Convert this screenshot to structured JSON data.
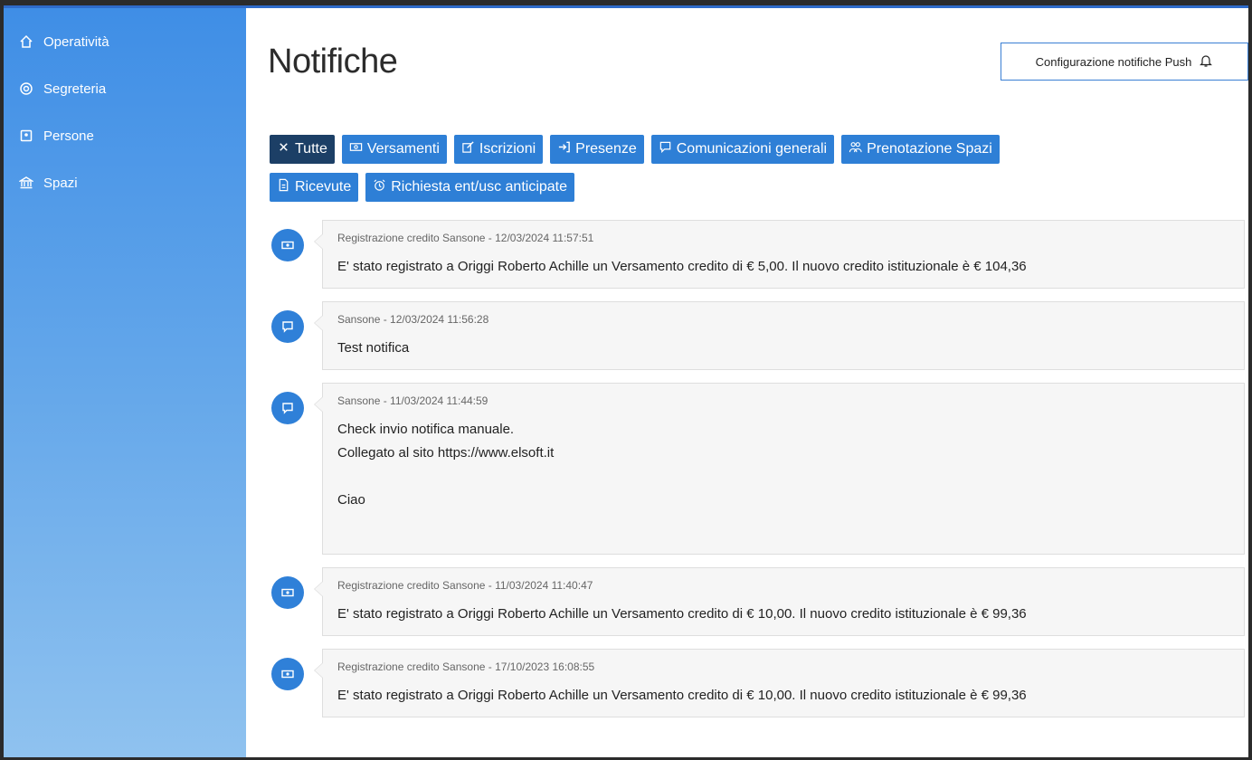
{
  "sidebar": {
    "items": [
      {
        "label": "Operatività",
        "icon": "home-icon"
      },
      {
        "label": "Segreteria",
        "icon": "lifebuoy-icon"
      },
      {
        "label": "Persone",
        "icon": "id-card-icon"
      },
      {
        "label": "Spazi",
        "icon": "bank-icon"
      }
    ]
  },
  "header": {
    "title": "Notifiche",
    "push_button_label": "Configurazione notifiche Push"
  },
  "filters": [
    {
      "label": "Tutte",
      "icon": "close-icon",
      "active": true
    },
    {
      "label": "Versamenti",
      "icon": "money-icon",
      "active": false
    },
    {
      "label": "Iscrizioni",
      "icon": "edit-icon",
      "active": false
    },
    {
      "label": "Presenze",
      "icon": "sign-in-icon",
      "active": false
    },
    {
      "label": "Comunicazioni generali",
      "icon": "comment-icon",
      "active": false
    },
    {
      "label": "Prenotazione Spazi",
      "icon": "people-icon",
      "active": false
    },
    {
      "label": "Ricevute",
      "icon": "receipt-icon",
      "active": false
    },
    {
      "label": "Richiesta ent/usc anticipate",
      "icon": "alarm-icon",
      "active": false
    }
  ],
  "notifications": [
    {
      "icon": "money-icon",
      "meta": "Registrazione credito Sansone - 12/03/2024 11:57:51",
      "body": "E' stato registrato a Origgi Roberto Achille un Versamento credito di € 5,00. Il nuovo credito istituzionale è € 104,36"
    },
    {
      "icon": "comment-icon",
      "meta": "Sansone - 12/03/2024 11:56:28",
      "body": "Test notifica"
    },
    {
      "icon": "comment-icon",
      "meta": "Sansone - 11/03/2024 11:44:59",
      "body": "Check invio notifica manuale.\nCollegato al sito https://www.elsoft.it\n\nCiao"
    },
    {
      "icon": "money-icon",
      "meta": "Registrazione credito Sansone - 11/03/2024 11:40:47",
      "body": "E' stato registrato a Origgi Roberto Achille un Versamento credito di € 10,00. Il nuovo credito istituzionale è € 99,36"
    },
    {
      "icon": "money-icon",
      "meta": "Registrazione credito Sansone - 17/10/2023 16:08:55",
      "body": "E' stato registrato a Origgi Roberto Achille un Versamento credito di € 10,00. Il nuovo credito istituzionale è € 99,36"
    }
  ]
}
